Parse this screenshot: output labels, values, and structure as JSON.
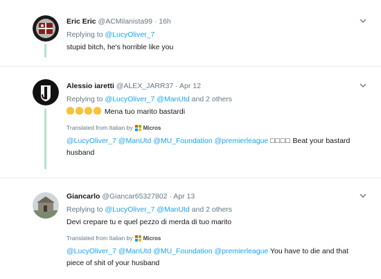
{
  "tweets": [
    {
      "name": "Eric Eric",
      "handle": "@ACMilanista99",
      "time": "16h",
      "replying_prefix": "Replying to",
      "replying_links": "@LucyOliver_7",
      "replying_suffix": "",
      "text": "stupid bitch, he's horrible like you"
    },
    {
      "name": "Alessio iaretti",
      "handle": "@ALEX_JARR37",
      "time": "Apr 12",
      "replying_prefix": "Replying to",
      "replying_links": "@LucyOliver_7 @ManUtd",
      "replying_suffix": "and 2 others",
      "text": "Mena tuo marito bastardi",
      "translated_label": "Translated from Italian by",
      "translator": "Micros",
      "trans_mentions": "@LucyOliver_7 @ManUtd @MU_Foundation @premierleague",
      "trans_boxes": "□□□□",
      "trans_text": "Beat your bastard husband"
    },
    {
      "name": "Giancarlo",
      "handle": "@Giancar65327802",
      "time": "Apr 13",
      "replying_prefix": "Replying to",
      "replying_links": "@LucyOliver_7 @ManUtd",
      "replying_suffix": "and 2 others",
      "text": "Devi crepare tu e quel pezzo di merda di tuo marito",
      "translated_label": "Translated from Italian by",
      "translator": "Micros",
      "trans_mentions": "@LucyOliver_7 @ManUtd @MU_Foundation @premierleague",
      "trans_text": "You have to die and that piece of shit of your husband"
    }
  ],
  "separator": "·",
  "colors": {
    "link": "#1da1f2",
    "muted": "#657786",
    "thread": "#b6e3c9"
  },
  "icons": [
    "chevron-down-icon",
    "microsoft-logo-icon",
    "raised-hand-emoji"
  ]
}
